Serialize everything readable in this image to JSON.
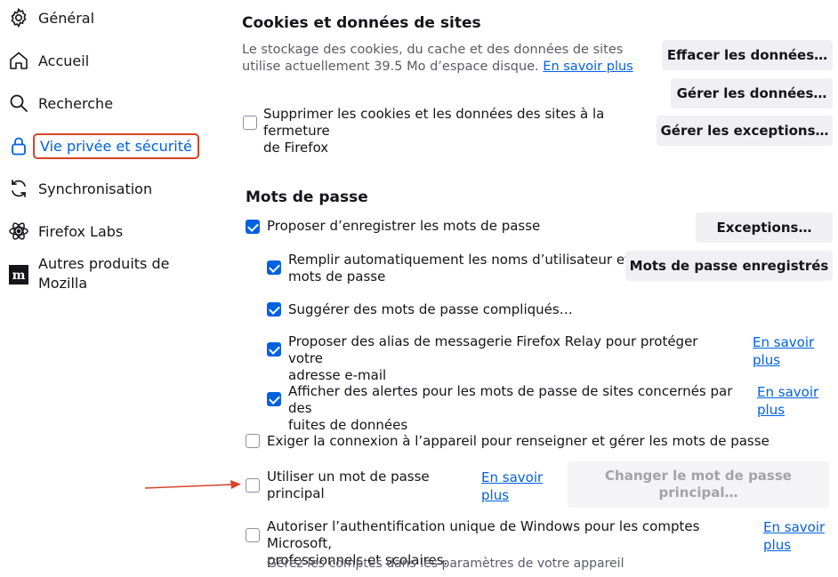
{
  "sidebar": {
    "items": [
      {
        "label": "Général",
        "icon": "gear-icon"
      },
      {
        "label": "Accueil",
        "icon": "home-icon"
      },
      {
        "label": "Recherche",
        "icon": "search-icon"
      },
      {
        "label": "Vie privée et sécurité",
        "icon": "lock-icon",
        "active": true
      },
      {
        "label": "Synchronisation",
        "icon": "sync-icon"
      },
      {
        "label": "Firefox Labs",
        "icon": "atom-icon"
      },
      {
        "label_line1": "Autres produits de",
        "label_line2": "Mozilla",
        "icon": "mozilla-icon"
      }
    ]
  },
  "cookies": {
    "title": "Cookies et données de sites",
    "desc_line1": "Le stockage des cookies, du cache et des données de sites",
    "desc_line2": "utilise actuellement 39.5 Mo d’espace disque.",
    "learn_more": "En savoir plus",
    "clear_button": "Effacer les données…",
    "manage_button": "Gérer les données…",
    "exceptions_button": "Gérer les exceptions…",
    "delete_on_close_line1": "Supprimer les cookies et les données des sites à la fermeture",
    "delete_on_close_line2": "de Firefox",
    "delete_on_close_checked": false
  },
  "passwords": {
    "title": "Mots de passe",
    "offer_save": "Proposer d’enregistrer les mots de passe",
    "exceptions_button": "Exceptions…",
    "autofill_line1": "Remplir automatiquement les noms d’utilisateur et",
    "autofill_line2": "mots de passe",
    "saved_passwords_button": "Mots de passe enregistrés",
    "suggest_strong": "Suggérer des mots de passe compliqués…",
    "relay_line1": "Proposer des alias de messagerie Firefox Relay pour protéger votre",
    "relay_line2": "adresse e-mail",
    "relay_learn_line1": "En savoir",
    "relay_learn_line2": "plus",
    "breach_line1": "Afficher des alertes pour les mots de passe de sites concernés par des",
    "breach_line2": "fuites de données",
    "breach_learn_line1": "En savoir",
    "breach_learn_line2": "plus",
    "require_device": "Exiger la connexion à l’appareil pour renseigner et gérer les mots de passe",
    "primary_line1": "Utiliser un mot de passe",
    "primary_line2": "principal",
    "primary_learn_line1": "En savoir",
    "primary_learn_line2": "plus",
    "change_primary_line1": "Changer le mot de passe",
    "change_primary_line2": "principal…",
    "sso_line1": "Autoriser l’authentification unique de Windows pour les comptes Microsoft,",
    "sso_line2": "professionnels et scolaires.",
    "sso_learn_line1": "En savoir",
    "sso_learn_line2": "plus",
    "sso_hint": "Gérez les comptes dans les paramètres de votre appareil"
  },
  "colors": {
    "accent": "#0061e0",
    "highlight_border": "#d5442a",
    "arrow": "#d5442a"
  }
}
